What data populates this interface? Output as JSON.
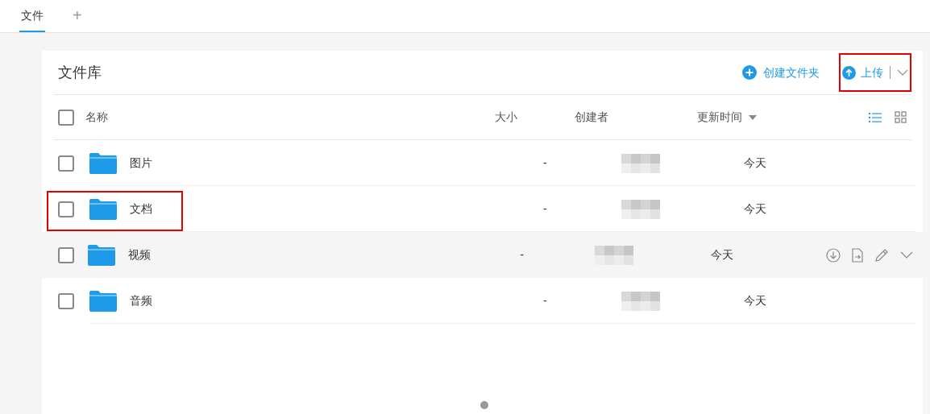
{
  "tabs": [
    {
      "label": "文件",
      "selected": true
    },
    {
      "label": "+",
      "selected": false
    }
  ],
  "library": {
    "title": "文件库",
    "create_folder": "创建文件夹",
    "upload": {
      "label": "上传",
      "annotated": true
    }
  },
  "table": {
    "select_all_checked": false,
    "columns": [
      {
        "label": "名称",
        "sorted": false
      },
      {
        "label": "大小",
        "sorted": false
      },
      {
        "label": "创建者",
        "sorted": false
      },
      {
        "label": "更新时间",
        "sorted": true
      }
    ],
    "rows": [
      {
        "name": "图片",
        "size": "-",
        "updated": "今天",
        "checked": false,
        "hovered": false,
        "annotated": false
      },
      {
        "name": "文档",
        "size": "-",
        "updated": "今天",
        "checked": false,
        "hovered": false,
        "annotated": true
      },
      {
        "name": "视频",
        "size": "-",
        "updated": "今天",
        "checked": false,
        "hovered": true,
        "annotated": false
      },
      {
        "name": "音频",
        "size": "-",
        "updated": "今天",
        "checked": false,
        "hovered": false,
        "annotated": false
      }
    ]
  }
}
